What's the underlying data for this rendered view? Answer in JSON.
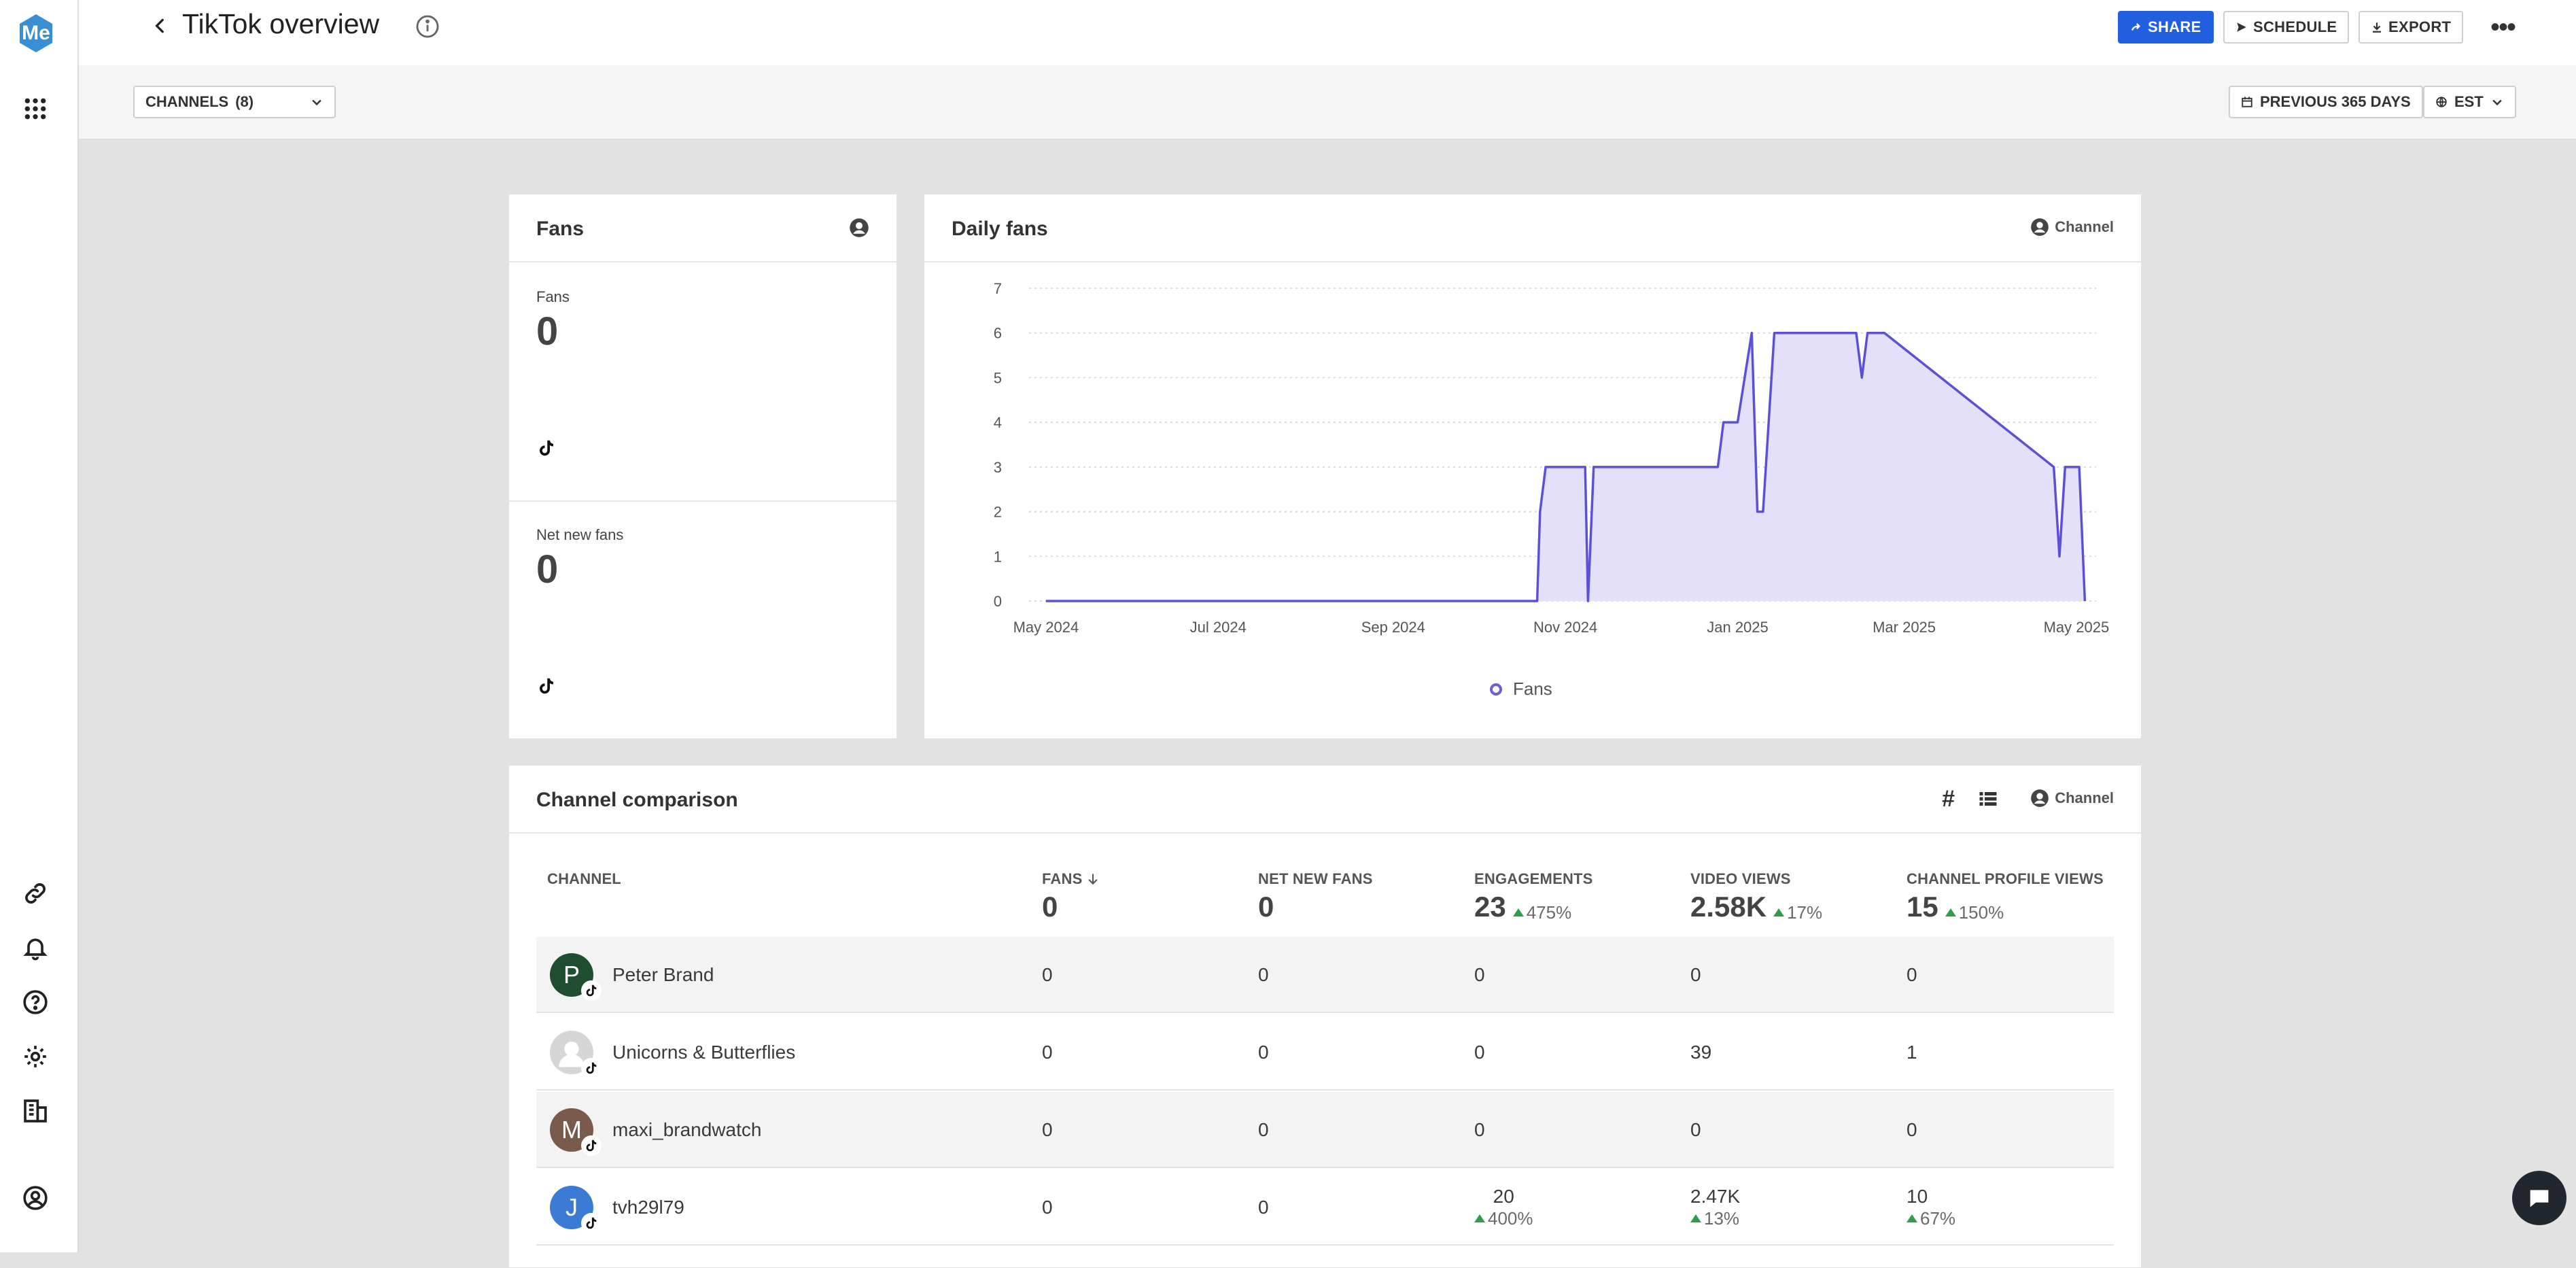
{
  "app": {
    "logo_text": "Me"
  },
  "header": {
    "title": "TikTok overview",
    "share_label": "SHARE",
    "schedule_label": "SCHEDULE",
    "export_label": "EXPORT"
  },
  "filters": {
    "channels_label": "CHANNELS",
    "channels_count": "(8)",
    "date_range_label": "PREVIOUS 365 DAYS",
    "timezone_label": "EST"
  },
  "fans_card": {
    "title": "Fans",
    "fans_label": "Fans",
    "fans_value": "0",
    "net_new_label": "Net new fans",
    "net_new_value": "0"
  },
  "daily_card": {
    "title": "Daily fans",
    "badge_label": "Channel"
  },
  "chart_data": {
    "type": "area",
    "title": "Daily fans",
    "xlabel": "",
    "ylabel": "",
    "ylim": [
      0,
      7
    ],
    "y_ticks": [
      "0",
      "1",
      "2",
      "3",
      "4",
      "5",
      "6",
      "7"
    ],
    "x_tick_labels": [
      "May 2024",
      "Jul 2024",
      "Sep 2024",
      "Nov 2024",
      "Jan 2025",
      "Mar 2025",
      "May 2025"
    ],
    "legend": "bottom-center",
    "grid": true,
    "color": "#5b50d6",
    "series": [
      {
        "name": "Fans",
        "x": [
          "2024-05-01",
          "2024-10-22",
          "2024-10-23",
          "2024-10-25",
          "2024-11-08",
          "2024-11-09",
          "2024-11-11",
          "2024-12-25",
          "2024-12-27",
          "2025-01-01",
          "2025-01-06",
          "2025-01-08",
          "2025-01-10",
          "2025-01-14",
          "2025-02-12",
          "2025-02-14",
          "2025-02-16",
          "2025-02-22",
          "2025-04-23",
          "2025-04-25",
          "2025-04-27",
          "2025-05-02",
          "2025-05-04"
        ],
        "y": [
          0,
          0,
          2,
          3,
          3,
          0,
          3,
          3,
          4,
          4,
          6,
          2,
          2,
          6,
          6,
          5,
          6,
          6,
          3,
          1,
          3,
          3,
          0
        ]
      }
    ]
  },
  "comparison": {
    "title": "Channel comparison",
    "badge_label": "Channel",
    "columns": {
      "channel": "CHANNEL",
      "fans": "FANS",
      "net_new_fans": "NET NEW FANS",
      "engagements": "ENGAGEMENTS",
      "video_views": "VIDEO VIEWS",
      "profile_views": "CHANNEL PROFILE VIEWS"
    },
    "totals": {
      "fans": "0",
      "net_new_fans": "0",
      "engagements": "23",
      "engagements_delta": "475%",
      "video_views": "2.58K",
      "video_views_delta": "17%",
      "profile_views": "15",
      "profile_views_delta": "150%"
    },
    "rows": [
      {
        "initial": "P",
        "name": "Peter Brand",
        "fans": "0",
        "net": "0",
        "eng": "0",
        "views": "0",
        "profile": "0"
      },
      {
        "initial": "",
        "name": "Unicorns & Butterflies",
        "fans": "0",
        "net": "0",
        "eng": "0",
        "views": "39",
        "profile": "1"
      },
      {
        "initial": "M",
        "name": "maxi_brandwatch",
        "fans": "0",
        "net": "0",
        "eng": "0",
        "views": "0",
        "profile": "0"
      },
      {
        "initial": "J",
        "name": "tvh29l79",
        "fans": "0",
        "net": "0",
        "eng": "20",
        "eng_delta": "400%",
        "views": "2.47K",
        "views_delta": "13%",
        "profile": "10",
        "profile_delta": "67%"
      }
    ]
  }
}
